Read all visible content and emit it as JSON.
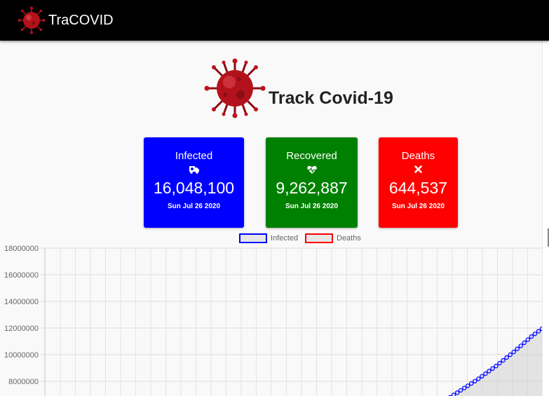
{
  "navbar": {
    "brand": "TraCOVID",
    "logo_icon": "virus-icon"
  },
  "hero": {
    "title": "Track Covid-19",
    "icon": "virus-icon"
  },
  "cards": {
    "infected": {
      "label": "Infected",
      "icon": "ambulance-icon",
      "value": "16,048,100",
      "date": "Sun Jul 26 2020",
      "color": "#0000ff"
    },
    "recovered": {
      "label": "Recovered",
      "icon": "heartbeat-icon",
      "value": "9,262,887",
      "date": "Sun Jul 26 2020",
      "color": "#008000"
    },
    "deaths": {
      "label": "Deaths",
      "icon": "close-icon",
      "value": "644,537",
      "date": "Sun Jul 26 2020",
      "color": "#ff0000"
    }
  },
  "chart_data": {
    "type": "line",
    "legend": [
      "Infected",
      "Deaths"
    ],
    "legend_position": "top",
    "grid": true,
    "ylim": [
      0,
      18000000
    ],
    "yticks": [
      "18000000",
      "16000000",
      "14000000",
      "12000000",
      "10000000",
      "8000000"
    ],
    "series": [
      {
        "name": "Infected",
        "color": "#0000ff",
        "values": [
          6800000,
          7250000,
          7700000,
          8150000,
          8650000,
          9150000,
          9700000,
          10250000,
          10850000,
          11450000,
          11950000
        ]
      },
      {
        "name": "Deaths",
        "color": "#ff0000",
        "values": []
      }
    ]
  }
}
